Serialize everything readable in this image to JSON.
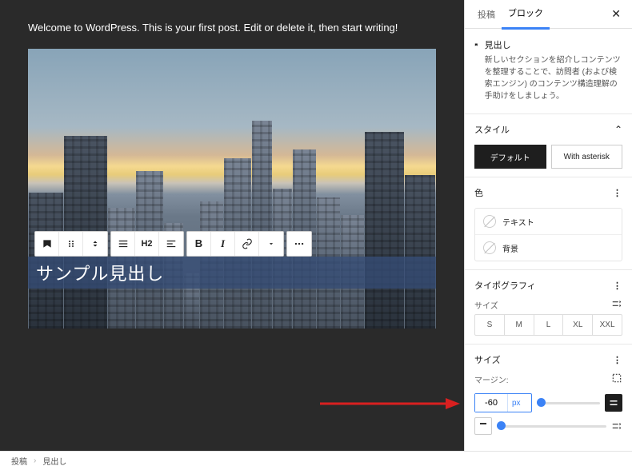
{
  "editor": {
    "paragraph": "Welcome to WordPress. This is your first post. Edit or delete it, then start writing!",
    "heading_sample": "サンプル見出し"
  },
  "toolbar": {
    "heading_level": "H2"
  },
  "sidebar": {
    "tabs": {
      "post": "投稿",
      "block": "ブロック"
    },
    "block_info": {
      "title": "見出し",
      "description": "新しいセクションを紹介しコンテンツを整理することで、訪問者 (および検索エンジン) のコンテンツ構造理解の手助けをしましょう。"
    },
    "style": {
      "label": "スタイル",
      "default": "デフォルト",
      "with_asterisk": "With asterisk"
    },
    "color": {
      "label": "色",
      "text": "テキスト",
      "background": "背景"
    },
    "typography": {
      "label": "タイポグラフィ",
      "size_label": "サイズ",
      "sizes": [
        "S",
        "M",
        "L",
        "XL",
        "XXL"
      ]
    },
    "dimensions": {
      "label": "サイズ",
      "margin_label": "マージン:",
      "margin_value": "-60",
      "margin_unit": "px"
    }
  },
  "footer": {
    "crumb1": "投稿",
    "crumb2": "見出し"
  }
}
